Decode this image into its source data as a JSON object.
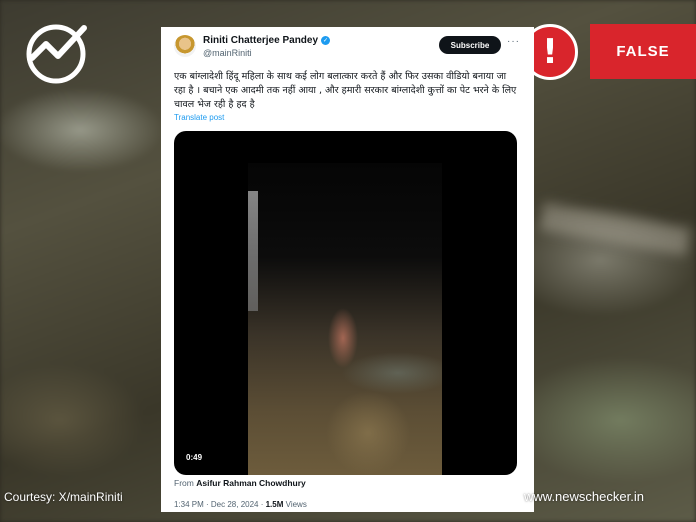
{
  "tweet": {
    "author_name": "Riniti Chatterjee Pandey",
    "handle": "@mainRiniti",
    "subscribe_label": "Subscribe",
    "more_label": "···",
    "text": "एक बांग्लादेशी हिंदू महिला के साथ कई लोग बलात्कार करते हैं और फिर उसका वीडियो बनाया जा रहा है । बचाने एक आदमी तक नहीं आया , और हमारी सरकार बांग्लादेशी कुत्तों का पेट भरने के लिए चावल भेज रही है हद है",
    "translate_label": "Translate post",
    "video": {
      "duration": "0:49",
      "from_label": "From",
      "from_source": "Asifur Rahman Chowdhury"
    },
    "timestamp": "1:34 PM · Dec 28, 2024 · ",
    "views_count": "1.5M",
    "views_label": " Views"
  },
  "verdict": {
    "label": "FALSE",
    "alert_symbol": "!",
    "color": "#d9252c"
  },
  "footer": {
    "courtesy": "Courtesy: X/mainRiniti",
    "site": "www.newschecker.in"
  }
}
